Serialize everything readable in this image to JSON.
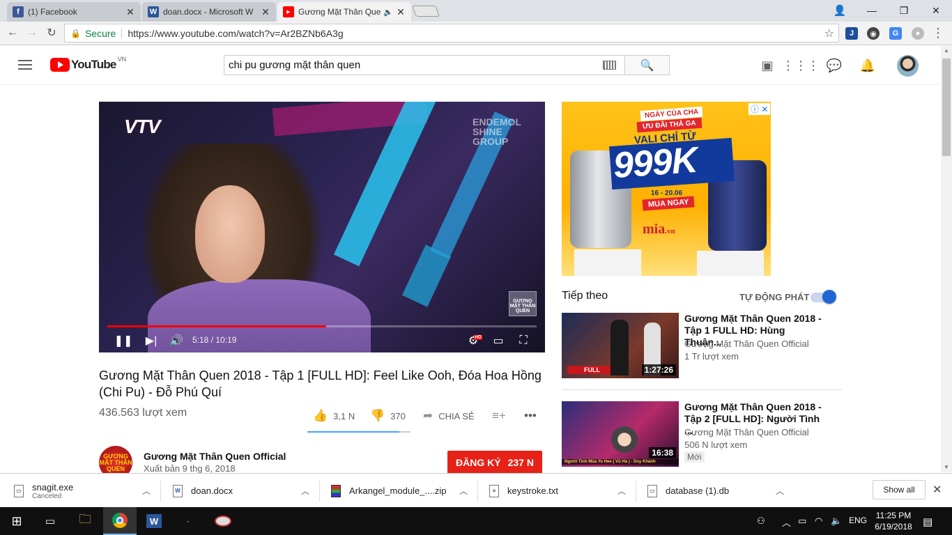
{
  "browser": {
    "tabs": [
      {
        "title": "(1) Facebook",
        "favicon_color": "#3b5998",
        "favicon_letter": "f"
      },
      {
        "title": "doan.docx - Microsoft W",
        "favicon_color": "#2b579a",
        "favicon_letter": "W"
      },
      {
        "title": "Gương Mặt Thân Que",
        "favicon_color": "#ff0000",
        "favicon_letter": "▶",
        "audio": "🔈"
      }
    ],
    "close_glyph": "✕",
    "window": {
      "user": "👤",
      "minimize": "—",
      "maximize": "❐",
      "close": "✕"
    },
    "address": {
      "secure_label": "Secure",
      "url": "https://www.youtube.com/watch?v=Ar2BZNb6A3g"
    }
  },
  "youtube": {
    "logo_text": "YouTube",
    "country": "VN",
    "search_value": "chi pu gương mặt thân quen",
    "player": {
      "watermark_vtv": "VTV",
      "watermark_endemol": "ENDEMOL\nSHINE\nGROUP",
      "corner_bug": "GƯƠNG MẶT THÂN QUEN",
      "time": "5:18 / 10:19",
      "progress": 0.51,
      "hd_badge": "HD"
    },
    "video": {
      "title": "Gương Mặt Thân Quen 2018 - Tập 1 [FULL HD]: Feel Like Ooh, Đóa Hoa Hồng (Chi Pu) - Đỗ Phú Quí",
      "views": "436.563 lượt xem",
      "likes": "3,1 N",
      "dislikes": "370",
      "share": "CHIA SẺ",
      "like_ratio": 0.89
    },
    "channel": {
      "name": "Gương Mặt Thân Quen Official",
      "published": "Xuất bản 9 thg 6, 2018",
      "avatar_text": "GƯƠNG MẶT THÂN QUEN",
      "subscribe_label": "ĐĂNG KÝ",
      "subscriber_count": "237 N"
    },
    "ad": {
      "line1": "NGÀY CỦA CHA",
      "line2": "ƯU ĐÃI THẢ GA",
      "line3": "VALI CHỈ TỪ",
      "price": "999K",
      "date": "16 - 20.06",
      "cta": "MUA NGAY",
      "brand": "mia",
      "brand_suffix": ".vn",
      "controls": "ⓘ ✕"
    },
    "up_next": {
      "heading": "Tiếp theo",
      "autoplay_label": "TỰ ĐỘNG PHÁT",
      "autoplay_on": true,
      "items": [
        {
          "title": "Gương Mặt Thân Quen 2018 - Tập 1 FULL HD: Hùng Thuận...",
          "channel": "Gương Mặt Thân Quen Official",
          "views": "1 Tr lượt xem",
          "duration": "1:27:26",
          "thumb_label": "FULL",
          "badge": ""
        },
        {
          "title": "Gương Mặt Thân Quen 2018 - Tập 2 [FULL HD]: Người Tình ...",
          "channel": "Gương Mặt Thân Quen Official",
          "views": "506 N lượt xem",
          "duration": "16:38",
          "thumb_label": "Người Tình Mùa Yo Hee ( Vũ Hà ) - Duy Khánh",
          "badge": "Mới"
        }
      ]
    }
  },
  "downloads": {
    "items": [
      {
        "name": "snagit.exe",
        "status": "Canceled",
        "type": "exe"
      },
      {
        "name": "doan.docx",
        "status": "",
        "type": "W"
      },
      {
        "name": "Arkangel_module_....zip",
        "status": "",
        "type": "zip"
      },
      {
        "name": "keystroke.txt",
        "status": "",
        "type": "txt"
      },
      {
        "name": "database (1).db",
        "status": "",
        "type": "db"
      }
    ],
    "show_all": "Show all"
  },
  "taskbar": {
    "language": "ENG",
    "time": "11:25 PM",
    "date": "6/19/2018"
  }
}
